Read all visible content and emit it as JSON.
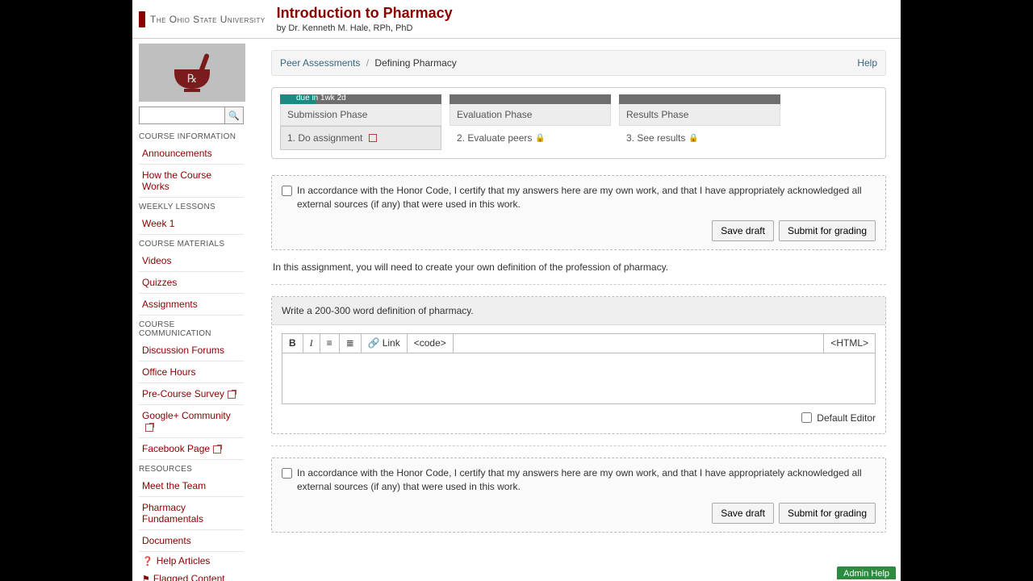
{
  "header": {
    "university": "The Ohio State University",
    "course_title": "Introduction to Pharmacy",
    "byline": "by Dr. Kenneth M. Hale, RPh, PhD"
  },
  "search": {
    "placeholder": ""
  },
  "sidebar": {
    "sections": [
      {
        "head": "COURSE INFORMATION",
        "items": [
          {
            "label": "Announcements"
          },
          {
            "label": "How the Course Works"
          }
        ]
      },
      {
        "head": "WEEKLY LESSONS",
        "items": [
          {
            "label": "Week 1"
          }
        ]
      },
      {
        "head": "COURSE MATERIALS",
        "items": [
          {
            "label": "Videos"
          },
          {
            "label": "Quizzes"
          },
          {
            "label": "Assignments"
          }
        ]
      },
      {
        "head": "COURSE COMMUNICATION",
        "items": [
          {
            "label": "Discussion Forums"
          },
          {
            "label": "Office Hours"
          },
          {
            "label": "Pre-Course Survey",
            "ext": true
          },
          {
            "label": "Google+ Community",
            "ext": true
          },
          {
            "label": "Facebook Page",
            "ext": true
          }
        ]
      },
      {
        "head": "RESOURCES",
        "items": [
          {
            "label": "Meet the Team"
          },
          {
            "label": "Pharmacy Fundamentals"
          },
          {
            "label": "Documents"
          }
        ]
      }
    ],
    "mini": [
      {
        "icon": "❓",
        "label": "Help Articles"
      },
      {
        "icon": "⚑",
        "label": "Flagged Content"
      }
    ]
  },
  "breadcrumb": {
    "root": "Peer Assessments",
    "current": "Defining Pharmacy",
    "help": "Help"
  },
  "phases": {
    "items": [
      {
        "title": "Submission Phase",
        "step": "1.  Do assignment",
        "fill": 22,
        "due": "due in 1wk 2d",
        "active": true,
        "locked": false
      },
      {
        "title": "Evaluation Phase",
        "step": "2.  Evaluate peers",
        "fill": 0,
        "due": "",
        "active": false,
        "locked": true
      },
      {
        "title": "Results Phase",
        "step": "3.  See results",
        "fill": 0,
        "due": "",
        "active": false,
        "locked": true
      }
    ]
  },
  "honor_text": "In accordance with the Honor Code, I certify that my answers here are my own work, and that I have appropriately acknowledged all external sources (if any) that were used in this work.",
  "buttons": {
    "save": "Save draft",
    "submit": "Submit for grading"
  },
  "assignment_instructions": "In this assignment, you will need to create your own definition of the profession of pharmacy.",
  "question": {
    "prompt": "Write a 200-300 word definition of pharmacy."
  },
  "editor": {
    "bold": "B",
    "italic": "I",
    "ul": "≡",
    "ol": "≣",
    "link": "Link",
    "code": "<code>",
    "html": "<HTML>",
    "default_label": "Default Editor"
  },
  "admin_help": "Admin Help"
}
